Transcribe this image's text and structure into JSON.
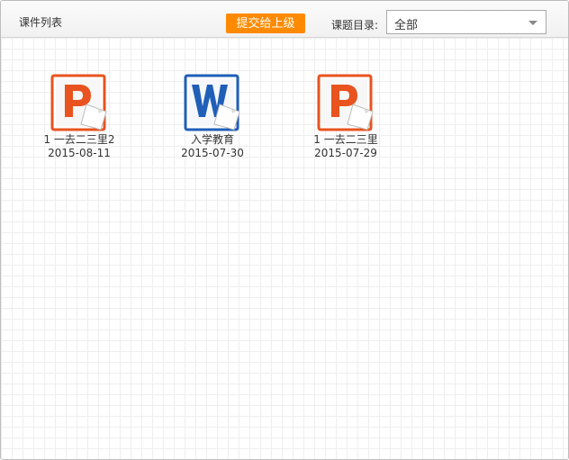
{
  "header": {
    "title": "课件列表",
    "submit_label": "提交给上级",
    "directory_label": "课题目录:",
    "directory_selected": "全部"
  },
  "files": [
    {
      "name": "1 一去二三里2",
      "date": "2015-08-11",
      "type": "ppt",
      "icon": "powerpoint-icon"
    },
    {
      "name": "入学教育",
      "date": "2015-07-30",
      "type": "word",
      "icon": "word-icon"
    },
    {
      "name": "1 一去二三里",
      "date": "2015-07-29",
      "type": "ppt",
      "icon": "powerpoint-icon"
    }
  ],
  "colors": {
    "accent": "#ff8a00",
    "powerpoint": "#e8531f",
    "word": "#1f5fb8"
  }
}
